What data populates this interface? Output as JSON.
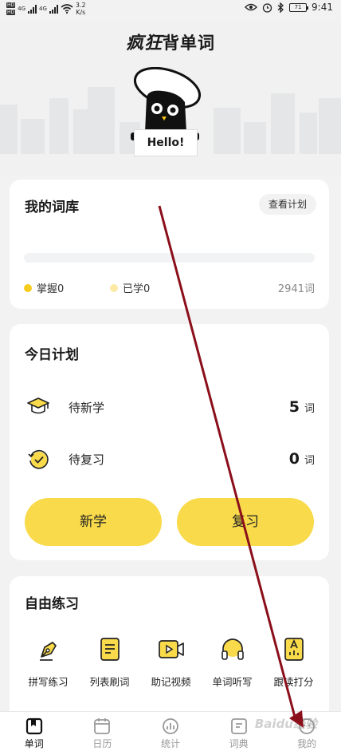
{
  "status_bar": {
    "sim1": "HD",
    "sim2": "HD",
    "net1": "4G",
    "net2": "4G",
    "speed_value": "3.2",
    "speed_unit": "K/s",
    "battery": "71",
    "time": "9:41"
  },
  "header": {
    "title_brand": "疯狂",
    "title_rest": "背单词",
    "mascot_text": "Hello!"
  },
  "vocab_card": {
    "title": "我的词库",
    "plan_button": "查看计划",
    "progress_fraction": 0,
    "mastered_label": "掌握0",
    "learned_label": "已学0",
    "total_label": "2941词",
    "colors": {
      "mastered": "#f5cc1e",
      "learned": "#fbe9a5"
    }
  },
  "today_card": {
    "title": "今日计划",
    "rows": [
      {
        "label": "待新学",
        "count": "5",
        "unit": "词",
        "icon": "graduation-cap-icon"
      },
      {
        "label": "待复习",
        "count": "0",
        "unit": "词",
        "icon": "review-clock-icon"
      }
    ],
    "new_button": "新学",
    "review_button": "复习"
  },
  "practice_card": {
    "title": "自由练习",
    "tools": [
      {
        "label": "拼写练习",
        "icon": "pen-nib-icon"
      },
      {
        "label": "列表刷词",
        "icon": "list-doc-icon"
      },
      {
        "label": "助记视频",
        "icon": "video-camera-icon"
      },
      {
        "label": "单词听写",
        "icon": "headphones-icon"
      },
      {
        "label": "跟读打分",
        "icon": "read-score-icon"
      }
    ]
  },
  "bottom_nav": [
    {
      "label": "单词",
      "icon": "book-icon",
      "active": true
    },
    {
      "label": "日历",
      "icon": "calendar-icon",
      "active": false
    },
    {
      "label": "统计",
      "icon": "stats-icon",
      "active": false
    },
    {
      "label": "词典",
      "icon": "dictionary-icon",
      "active": false
    },
    {
      "label": "我的",
      "icon": "profile-icon",
      "active": false
    }
  ],
  "watermark": "Baidu经验",
  "colors": {
    "accent": "#f8da4a",
    "annotation_arrow": "#8b0f1a"
  }
}
